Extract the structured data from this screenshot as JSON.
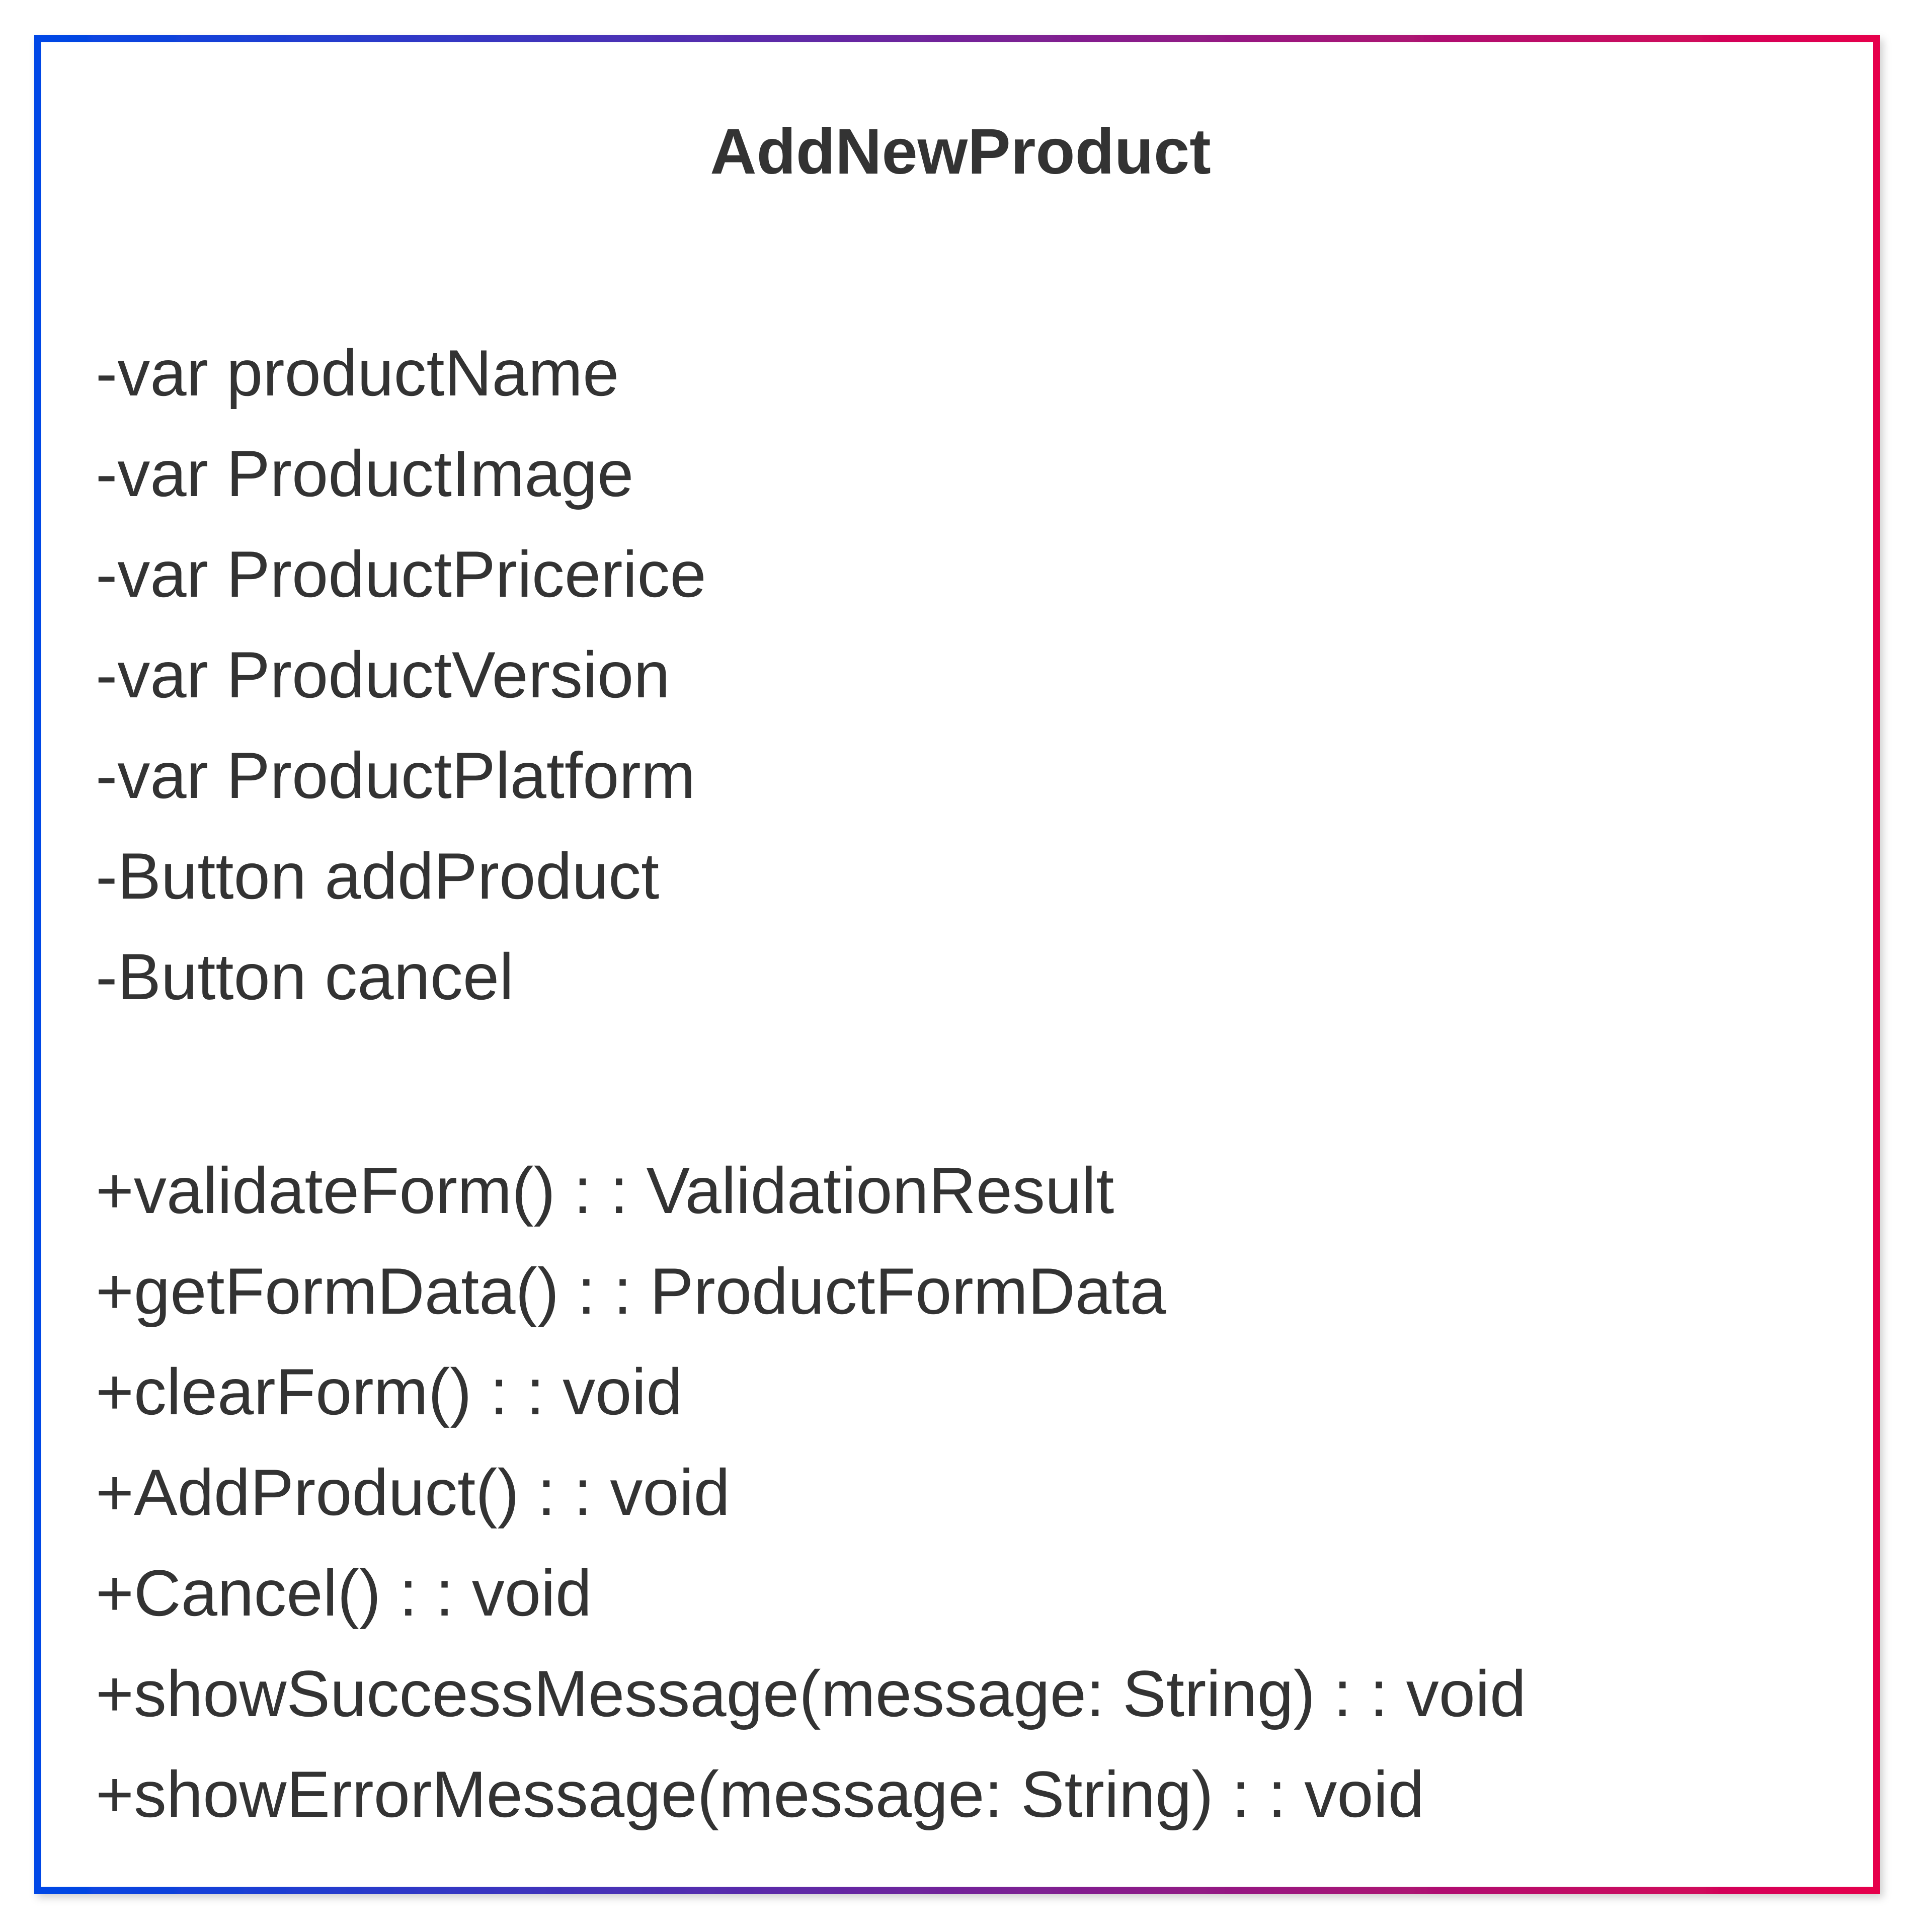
{
  "class_box": {
    "name": "AddNewProduct",
    "attributes": [
      "-var productName",
      "-var ProductImage",
      "-var ProductPricerice",
      "-var ProductVersion",
      "-var ProductPlatform",
      "-Button addProduct",
      "-Button cancel"
    ],
    "methods": [
      "+validateForm() : : ValidationResult",
      "+getFormData() : : ProductFormData",
      "+clearForm() : : void",
      "+AddProduct() : : void",
      "+Cancel() : : void",
      "+showSuccessMessage(message: String) : : void",
      "+showErrorMessage(message: String) : : void"
    ]
  },
  "colors": {
    "gradient_start": "#0047e6",
    "gradient_end": "#e6004c",
    "text": "#333333",
    "background": "#ffffff"
  }
}
